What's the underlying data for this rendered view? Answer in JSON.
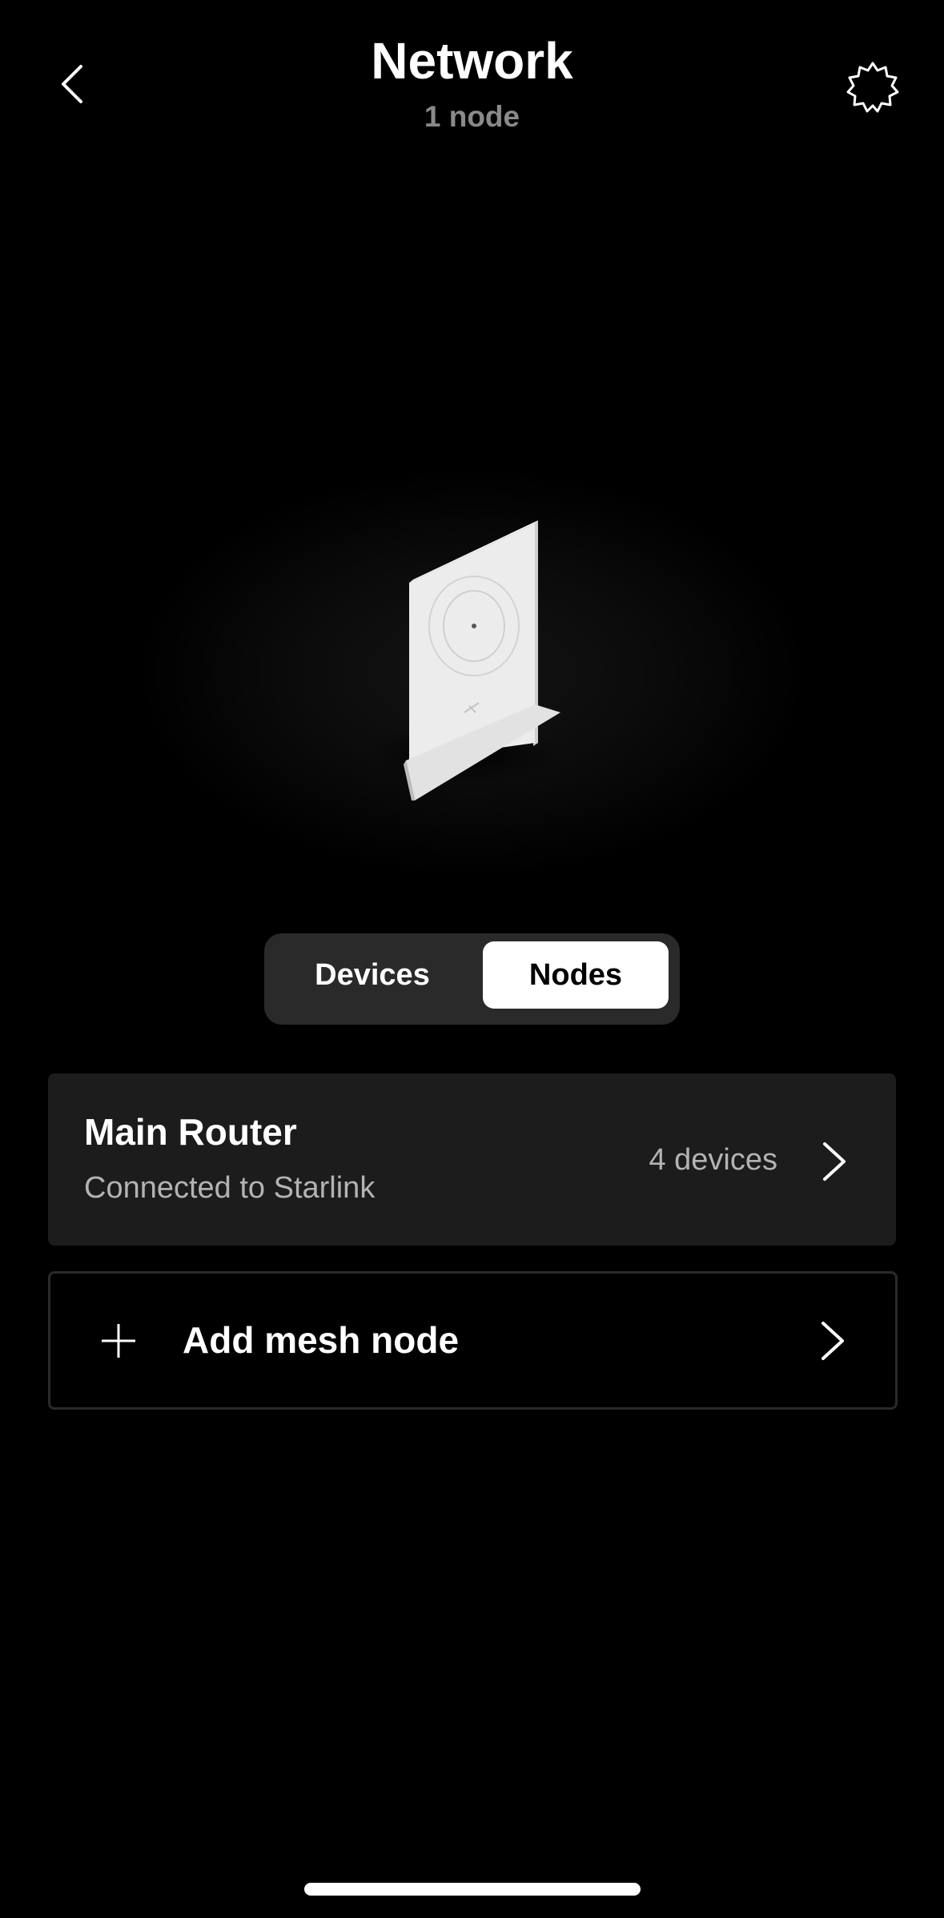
{
  "header": {
    "title": "Network",
    "subtitle": "1 node",
    "back_icon": "chevron-left-icon",
    "settings_icon": "gear-icon"
  },
  "tabs": {
    "items": [
      {
        "label": "Devices",
        "selected": false
      },
      {
        "label": "Nodes",
        "selected": true
      }
    ]
  },
  "nodes": [
    {
      "name": "Main Router",
      "status": "Connected to Starlink",
      "devices": "4 devices",
      "icon": "chevron-right-icon"
    }
  ],
  "add_node": {
    "label": "Add mesh node",
    "icon": "plus-icon",
    "chevron": "chevron-right-icon"
  },
  "colors": {
    "background": "#000000",
    "card": "#1c1c1c",
    "segmented_bg": "#2a2a2a",
    "selected_tab": "#ffffff",
    "muted_text": "#b3b3b3",
    "subtitle_text": "#8a8a8a"
  }
}
